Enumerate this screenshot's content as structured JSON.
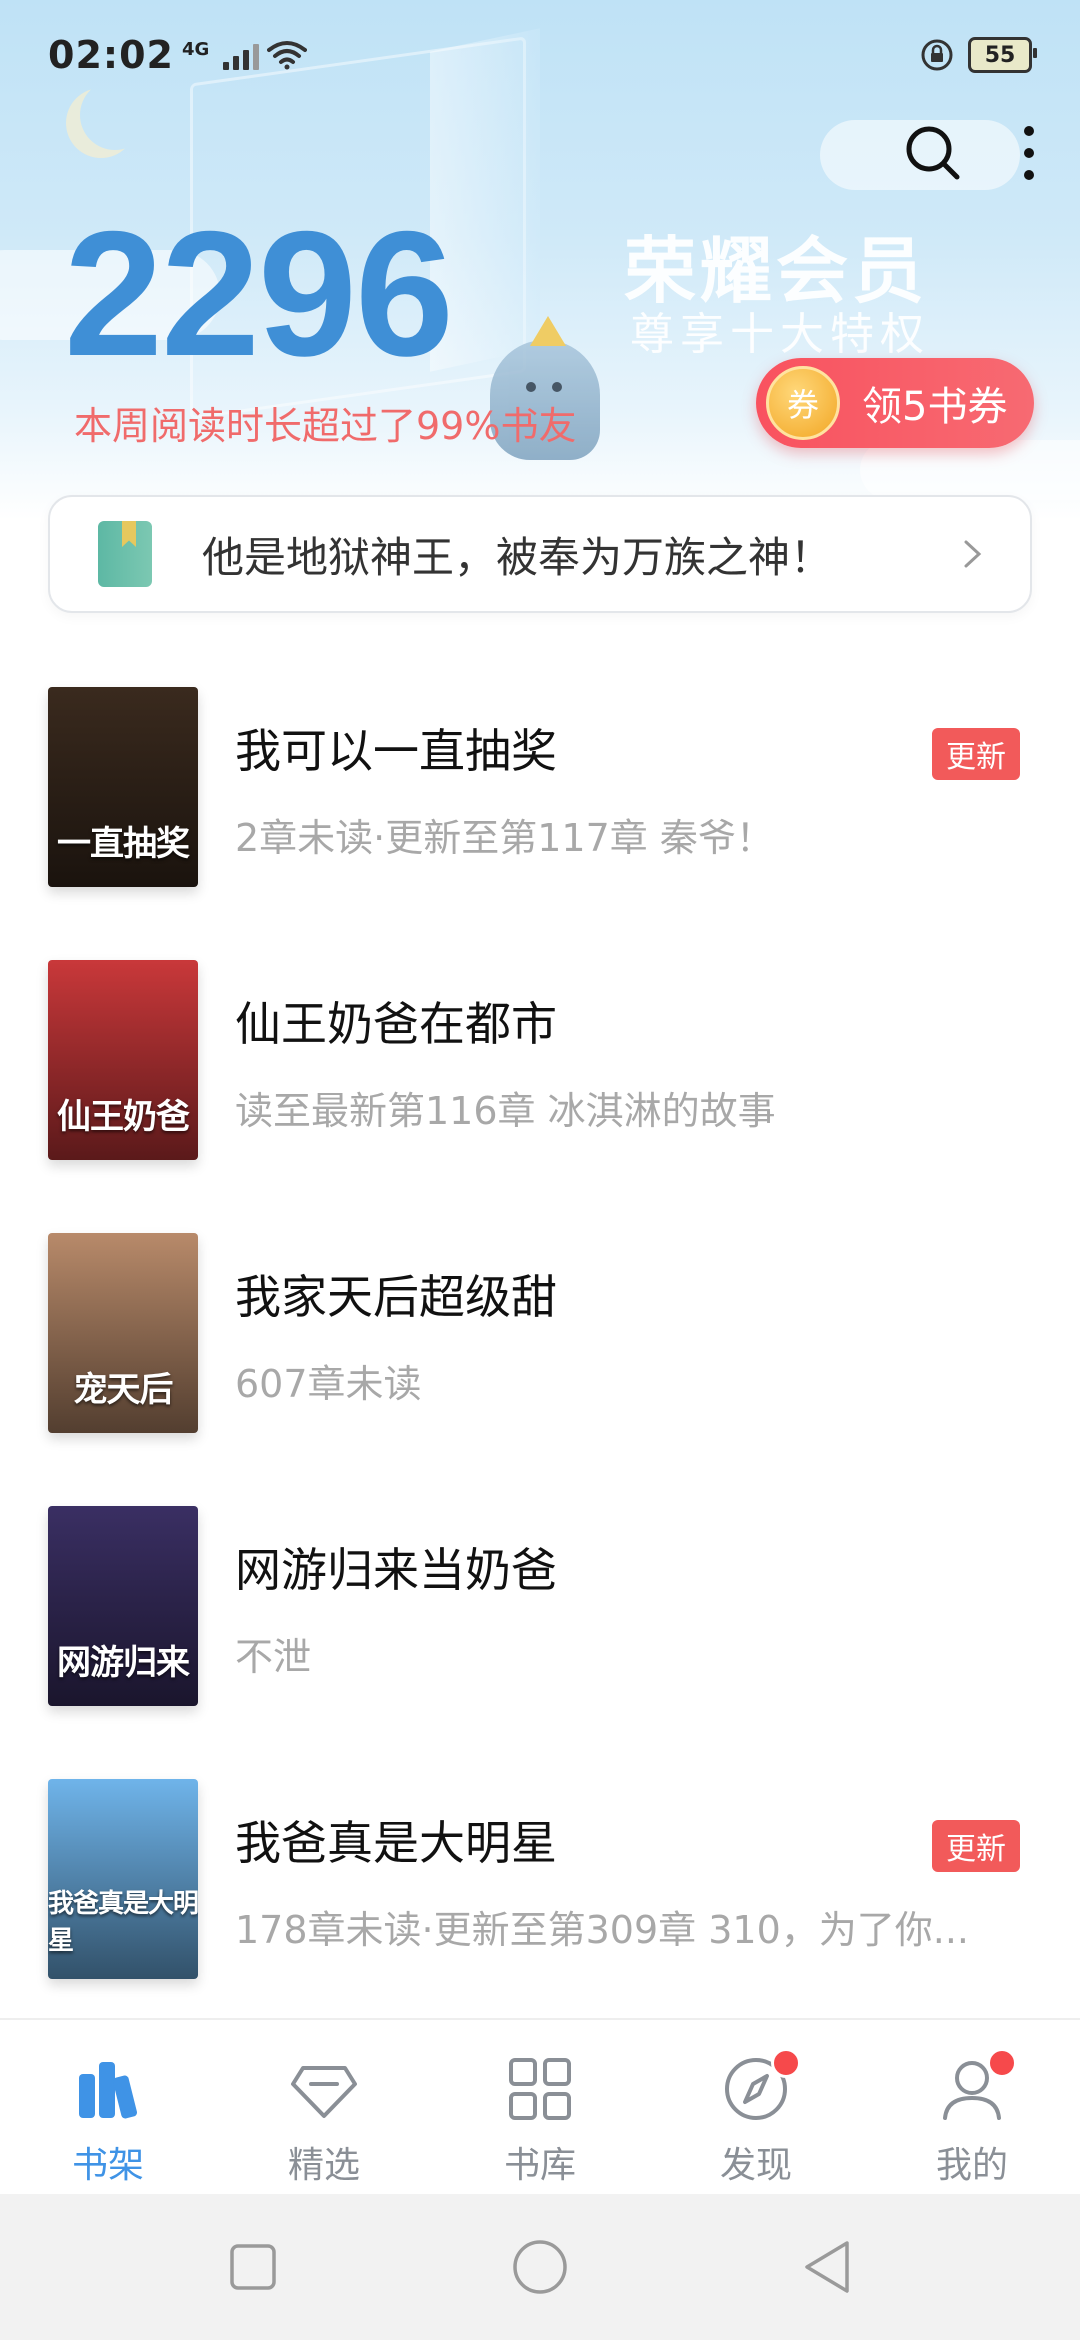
{
  "status_bar": {
    "time": "02:02",
    "network": "4G",
    "battery": "55"
  },
  "header": {
    "read_count": "2296",
    "read_subtitle": "本周阅读时长超过了99%书友",
    "vip_title": "荣耀会员",
    "vip_subtitle": "尊享十大特权",
    "coupon_icon_label": "券",
    "coupon_label": "领5书券",
    "icons": [
      "search-icon",
      "more-vertical-icon"
    ]
  },
  "notice": {
    "text": "他是地狱神王，被奉为万族之神！",
    "icon": "green-book-icon"
  },
  "books": [
    {
      "title": "我可以一直抽奖",
      "meta": "2章未读·更新至第117章 秦爷！",
      "badge": "更新",
      "cover_text": "一直抽奖",
      "cover_color": "#3a2a1e"
    },
    {
      "title": "仙王奶爸在都市",
      "meta": "读至最新第116章 冰淇淋的故事",
      "badge": "",
      "cover_text": "仙王奶爸",
      "cover_color": "#c9383a"
    },
    {
      "title": "我家天后超级甜",
      "meta": "607章未读",
      "badge": "",
      "cover_text": "宠天后",
      "cover_color": "#b88a6a"
    },
    {
      "title": "网游归来当奶爸",
      "meta": "不泄",
      "badge": "",
      "cover_text": "网游归来",
      "cover_color": "#3a2f63"
    },
    {
      "title": "我爸真是大明星",
      "meta": "178章未读·更新至第309章 310，为了你...",
      "badge": "更新",
      "cover_text": "我爸真是大明星",
      "cover_color": "#6fb4ea"
    }
  ],
  "tabs": [
    {
      "label": "书架",
      "icon": "bookshelf-icon",
      "active": true,
      "dot": false
    },
    {
      "label": "精选",
      "icon": "diamond-icon",
      "active": false,
      "dot": false
    },
    {
      "label": "书库",
      "icon": "grid-icon",
      "active": false,
      "dot": false
    },
    {
      "label": "发现",
      "icon": "compass-icon",
      "active": false,
      "dot": true
    },
    {
      "label": "我的",
      "icon": "user-icon",
      "active": false,
      "dot": true
    }
  ],
  "nav_buttons": [
    "recent-apps-icon",
    "home-icon",
    "back-icon"
  ],
  "colors": {
    "accent": "#3f93e6",
    "badge": "#f25a5a",
    "read_sub": "#f06b6b",
    "coupon": "#f9525f"
  }
}
